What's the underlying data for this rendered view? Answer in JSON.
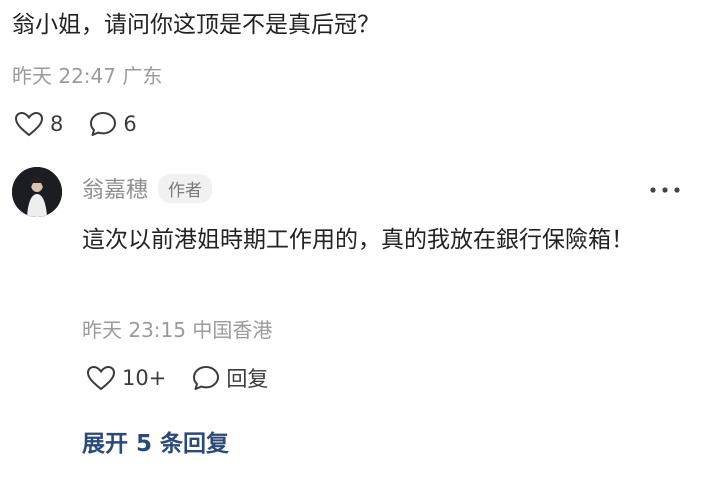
{
  "main_comment": {
    "text": "翁小姐，请问你这顶是不是真后冠？",
    "meta": "昨天 22:47 广东",
    "likes": "8",
    "replies": "6"
  },
  "reply": {
    "author": "翁嘉穗",
    "author_badge": "作者",
    "text": "這次以前港姐時期工作用的，真的我放在銀行保險箱！",
    "meta": "昨天 23:15 中国香港",
    "likes": "10+",
    "reply_label": "回复"
  },
  "expand_label": "展开 5 条回复",
  "colors": {
    "text": "#222222",
    "meta": "#9b9b9b",
    "link": "#2b4a7a",
    "badge_bg": "#f1f1f1"
  },
  "icons": {
    "like": "heart-outline-icon",
    "comment": "speech-bubble-icon",
    "more": "more-dots-icon"
  }
}
